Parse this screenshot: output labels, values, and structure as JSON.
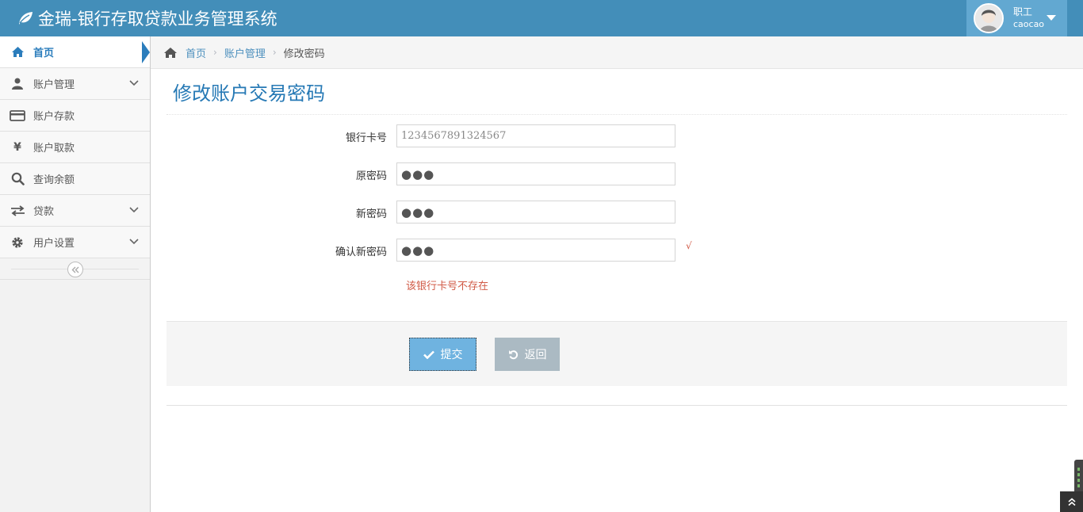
{
  "app": {
    "title": "金瑞-银行存取贷款业务管理系统"
  },
  "user": {
    "role": "职工",
    "username": "caocao"
  },
  "sidebar": {
    "items": [
      {
        "label": "首页",
        "icon": "home-icon",
        "active": true,
        "expandable": false
      },
      {
        "label": "账户管理",
        "icon": "user-icon",
        "active": false,
        "expandable": true
      },
      {
        "label": "账户存款",
        "icon": "credit-card-icon",
        "active": false,
        "expandable": false
      },
      {
        "label": "账户取款",
        "icon": "yen-icon",
        "active": false,
        "expandable": false
      },
      {
        "label": "查询余额",
        "icon": "search-icon",
        "active": false,
        "expandable": false
      },
      {
        "label": "贷款",
        "icon": "exchange-icon",
        "active": false,
        "expandable": true
      },
      {
        "label": "用户设置",
        "icon": "cog-icon",
        "active": false,
        "expandable": true
      }
    ]
  },
  "breadcrumb": {
    "home": "首页",
    "section": "账户管理",
    "current": "修改密码"
  },
  "page": {
    "title": "修改账户交易密码"
  },
  "form": {
    "card_label": "银行卡号",
    "card_value": "1234567891324567",
    "old_pw_label": "原密码",
    "old_pw_value": "●●●",
    "new_pw_label": "新密码",
    "new_pw_value": "●●●",
    "confirm_pw_label": "确认新密码",
    "confirm_pw_value": "●●●",
    "confirm_check": "√",
    "error": "该银行卡号不存在"
  },
  "actions": {
    "submit": "提交",
    "back": "返回"
  },
  "colors": {
    "navbar": "#438eb9",
    "accent": "#2679b5",
    "error": "#d15b47",
    "submit": "#6fb3e0",
    "back": "#abbac3"
  }
}
